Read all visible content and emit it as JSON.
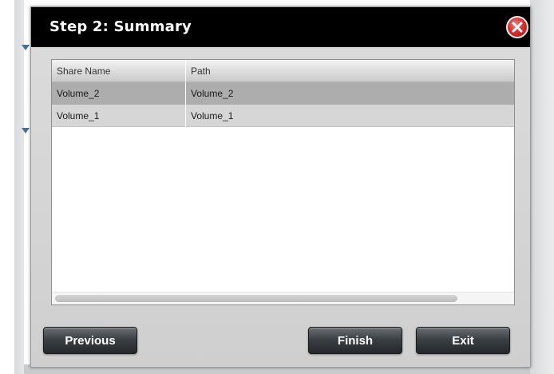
{
  "dialog": {
    "title": "Step 2: Summary",
    "close_icon": "close-icon"
  },
  "table": {
    "columns": [
      "Share Name",
      "Path"
    ],
    "rows": [
      {
        "share_name": "Volume_2",
        "path": "Volume_2",
        "selected": true
      },
      {
        "share_name": "Volume_1",
        "path": "Volume_1",
        "selected": false
      }
    ]
  },
  "buttons": {
    "previous": "Previous",
    "finish": "Finish",
    "exit": "Exit"
  },
  "colors": {
    "title_bar": "#000000",
    "close_button": "#d43232",
    "selected_row": "#adadad",
    "button": "#3b4045"
  }
}
